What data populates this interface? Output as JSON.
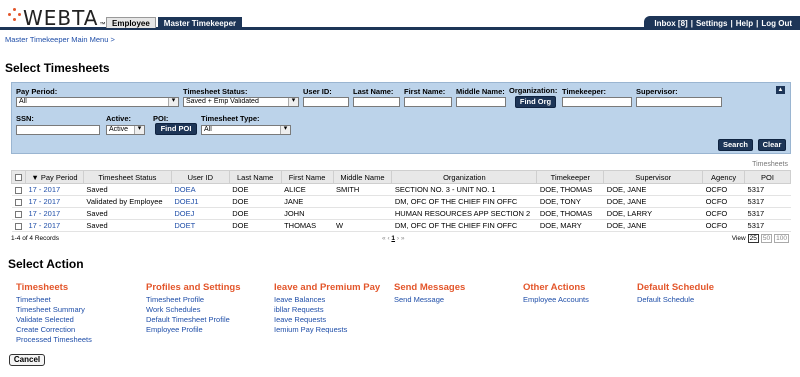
{
  "header": {
    "logo_text": "WEBTA",
    "logo_tm": "™",
    "roles": [
      "Employee",
      "Master Timekeeper"
    ],
    "links": [
      "Inbox [8]",
      "Settings",
      "Help",
      "Log Out"
    ]
  },
  "breadcrumb": "Master Timekeeper Main Menu >",
  "page_title": "Select Timesheets",
  "search": {
    "pay_period_label": "Pay Period:",
    "pay_period_value": "All",
    "status_label": "Timesheet Status:",
    "status_value": "Saved + Emp Validated",
    "user_id_label": "User ID:",
    "last_name_label": "Last Name:",
    "first_name_label": "First Name:",
    "middle_name_label": "Middle Name:",
    "org_label": "Organization:",
    "find_org": "Find Org",
    "timekeeper_label": "Timekeeper:",
    "supervisor_label": "Supervisor:",
    "ssn_label": "SSN:",
    "active_label": "Active:",
    "active_value": "Active",
    "poi_label": "POI:",
    "find_poi": "Find POI",
    "type_label": "Timesheet Type:",
    "type_value": "All",
    "search_button": "Search",
    "clear_button": "Clear"
  },
  "table": {
    "caption": "Timesheets",
    "columns": [
      "Pay Period",
      "Timesheet Status",
      "User ID",
      "Last Name",
      "First Name",
      "Middle Name",
      "Organization",
      "Timekeeper",
      "Supervisor",
      "Agency",
      "POI"
    ],
    "rows": [
      [
        "17 - 2017",
        "Saved",
        "DOEA",
        "DOE",
        "ALICE",
        "SMITH",
        "SECTION NO. 3 - UNIT NO. 1",
        "DOE, THOMAS",
        "DOE, JANE",
        "OCFO",
        "5317"
      ],
      [
        "17 - 2017",
        "Validated by Employee",
        "DOEJ1",
        "DOE",
        "JANE",
        "",
        "DM, OFC OF THE CHIEF FIN OFFC",
        "DOE, TONY",
        "DOE, JANE",
        "OCFO",
        "5317"
      ],
      [
        "17 - 2017",
        "Saved",
        "DOEJ",
        "DOE",
        "JOHN",
        "",
        "HUMAN RESOURCES APP SECTION 2",
        "DOE, THOMAS",
        "DOE, LARRY",
        "OCFO",
        "5317"
      ],
      [
        "17 - 2017",
        "Saved",
        "DOET",
        "DOE",
        "THOMAS",
        "W",
        "DM, OFC OF THE CHIEF FIN OFFC",
        "DOE, MARY",
        "DOE, JANE",
        "OCFO",
        "5317"
      ]
    ],
    "records": "1-4 of 4 Records",
    "pager": {
      "first": "«",
      "prev": "‹",
      "current": "1",
      "next": "›",
      "last": "»"
    },
    "view_label": "View",
    "view_options": [
      "25",
      "50",
      "100"
    ]
  },
  "actions": {
    "title": "Select Action",
    "groups": [
      {
        "title": "Timesheets",
        "items": [
          "Timesheet",
          "Timesheet Summary",
          "Validate Selected",
          "Create Correction",
          "Processed Timesheets"
        ]
      },
      {
        "title": "Profiles and Settings",
        "items": [
          "Timesheet Profile",
          "Work Schedules",
          "Default Timesheet Profile",
          "Employee Profile"
        ]
      },
      {
        "title": "Ieave and Premium Pay",
        "items": [
          "Ieave Balances",
          "ibllar Requests",
          "Ieave Requests",
          "Iemium Pay Requests"
        ]
      },
      {
        "title": "Send Messages",
        "items": [
          "Send Message"
        ]
      },
      {
        "title": "Other Actions",
        "items": [
          "Employee Accounts"
        ]
      },
      {
        "title": "Default Schedule",
        "items": [
          "Default Schedule"
        ]
      }
    ]
  },
  "cancel": "Cancel"
}
